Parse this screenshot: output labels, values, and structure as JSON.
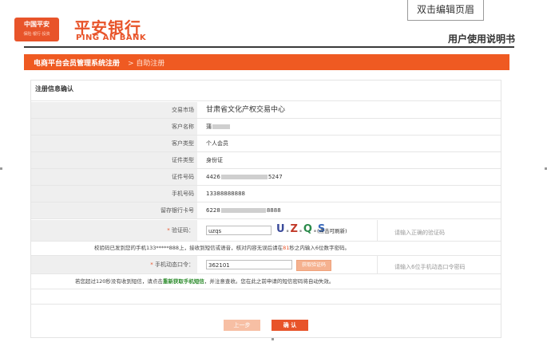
{
  "header": {
    "logo_text": "中国平安",
    "logo_sub": "保险·银行·投资",
    "brand_cn": "平安银行",
    "brand_en": "PING AN BANK",
    "edit_button": "双击编辑页眉",
    "manual_title": "用户使用说明书"
  },
  "breadcrumb": {
    "section": "电商平台会员管理系统注册",
    "separator": ">",
    "current": "自助注册"
  },
  "form": {
    "title": "注册信息确认",
    "rows": [
      {
        "label": "交易市场",
        "value": "甘肃省文化产权交易中心"
      },
      {
        "label": "客户名称",
        "value": "蒲"
      },
      {
        "label": "客户类型",
        "value": "个人会员"
      },
      {
        "label": "证件类型",
        "value": "身份证"
      },
      {
        "label": "证件号码",
        "prefix": "4426",
        "suffix": "5247"
      },
      {
        "label": "手机号码",
        "value": "13388888888"
      },
      {
        "label": "留存银行卡号",
        "prefix": "6228",
        "suffix": "8888"
      }
    ],
    "captcha": {
      "star": "*",
      "label": "验证码：",
      "value": "uzqs",
      "image_text": "U.Z.Q.S",
      "refresh": "(点击可刷新)",
      "hint": "请输入正确的验证码"
    },
    "sms_notice": {
      "before": "校验码已发到您的手机133*****888上，接收到短信或语音，核对内容无误后请在",
      "seconds": "81",
      "after": "秒之内输入6位数字密码。"
    },
    "sms_code": {
      "star": "*",
      "label": "手机动态口令：",
      "value": "362101",
      "button": "获取验证码",
      "hint": "请输入6位手机动态口令密码"
    },
    "resend_notice": {
      "before": "若您超过120秒没有收到短信，请点击",
      "link": "重新获取手机短信",
      "after": "，并注意查收。您在此之前申请的短信密码将自动失效。"
    }
  },
  "buttons": {
    "prev": "上一步",
    "confirm": "确 认"
  }
}
